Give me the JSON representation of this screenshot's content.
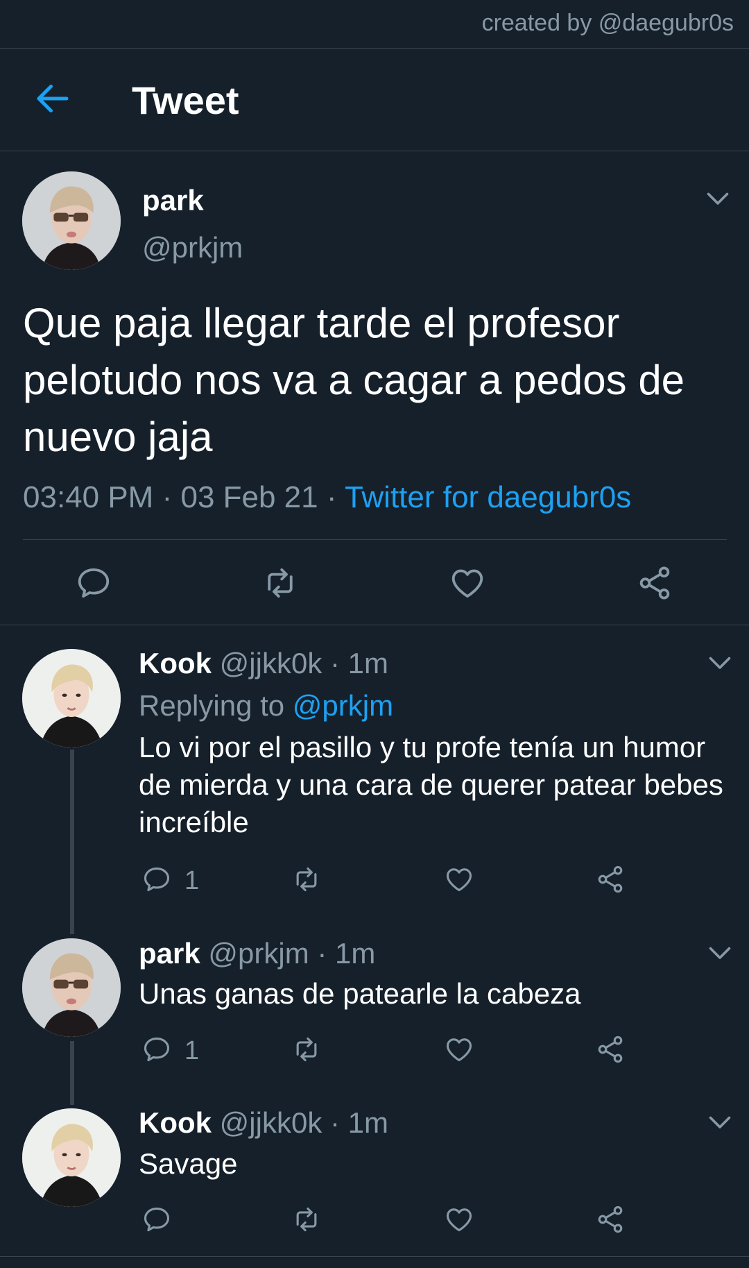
{
  "credit": "created by @daegubr0s",
  "header": {
    "title": "Tweet"
  },
  "main_tweet": {
    "name": "park",
    "handle": "@prkjm",
    "text": "Que paja llegar tarde el profesor pelotudo nos va a cagar a pedos de nuevo jaja",
    "time": "03:40 PM",
    "sep1": "·",
    "date": "03 Feb 21",
    "sep2": "·",
    "source": "Twitter for daegubr0s"
  },
  "replies": [
    {
      "name": "Kook",
      "handle": "@jjkk0k",
      "sep": "·",
      "time": "1m",
      "replying_label": "Replying to",
      "replying_handle": "@prkjm",
      "text": "Lo vi por el pasillo y tu profe tenía un humor de mierda y una cara de querer patear bebes increíble",
      "reply_count": "1"
    },
    {
      "name": "park",
      "handle": "@prkjm",
      "sep": "·",
      "time": "1m",
      "text": "Unas ganas de patearle la cabeza",
      "reply_count": "1"
    },
    {
      "name": "Kook",
      "handle": "@jjkk0k",
      "sep": "·",
      "time": "1m",
      "text": "Savage"
    }
  ],
  "colors": {
    "background": "#15202b",
    "accent": "#1da1f2",
    "muted": "#8899a6",
    "border": "#38444d"
  },
  "icons": [
    "back-arrow-icon",
    "chevron-down-icon",
    "reply-icon",
    "retweet-icon",
    "like-icon",
    "share-icon"
  ]
}
